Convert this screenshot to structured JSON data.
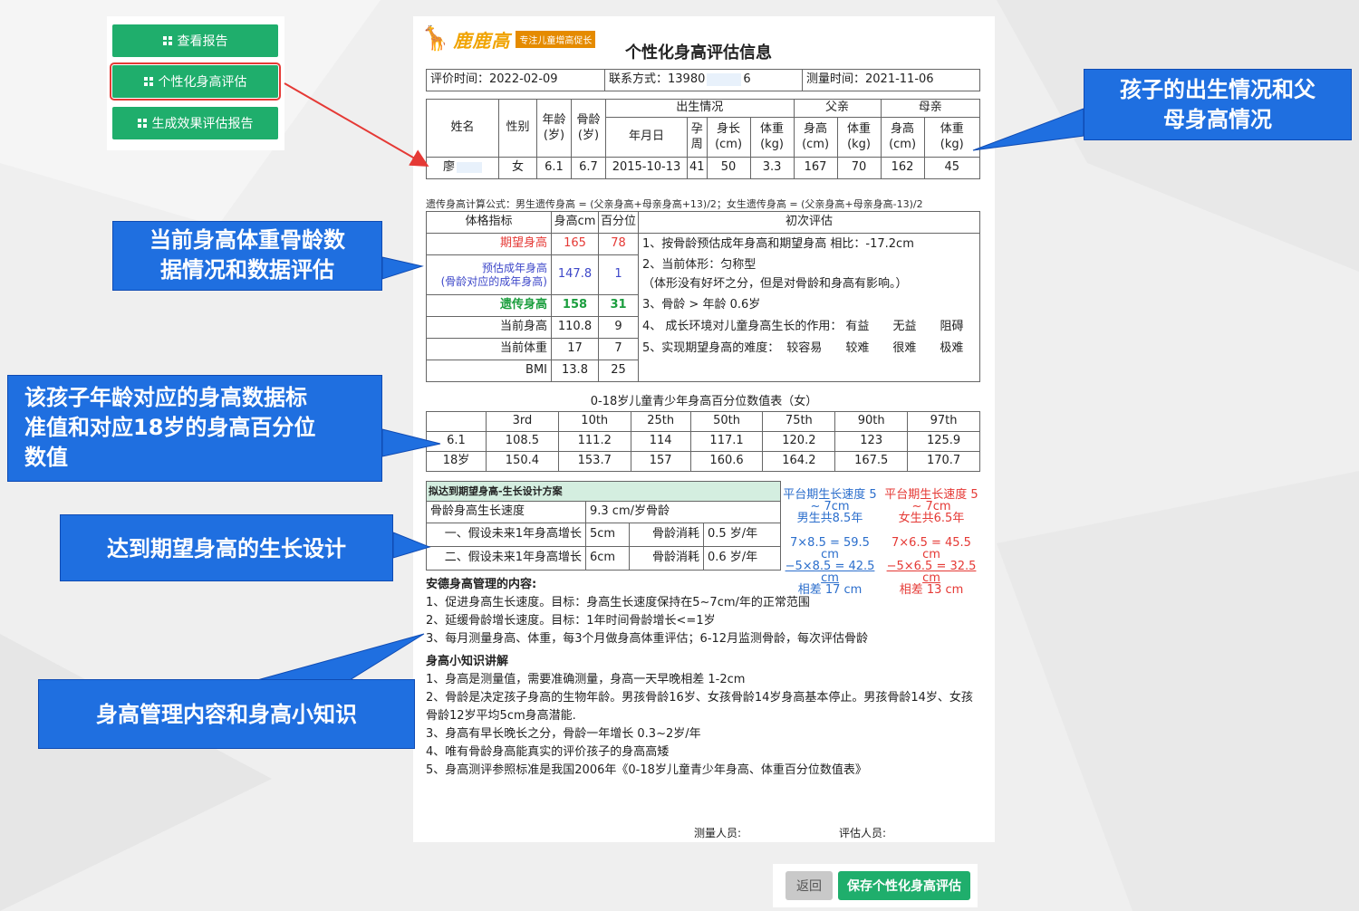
{
  "menu": {
    "items": [
      {
        "label": "查看报告"
      },
      {
        "label": "个性化身高评估"
      },
      {
        "label": "生成效果评估报告"
      }
    ]
  },
  "report": {
    "brand": "鹿鹿高",
    "slogan": "专注儿童增高促长",
    "title": "个性化身高评估信息",
    "meta": {
      "eval_time": "评价时间：2022-02-09",
      "contact": "联系方式：13980",
      "contact_tail": "6",
      "measure_time": "测量时间：2021-11-06"
    },
    "patient": {
      "headers": {
        "name": "姓名",
        "gender": "性别",
        "age": "年龄\n(岁)",
        "bone_age": "骨龄\n(岁)",
        "birth": "出生情况",
        "father": "父亲",
        "mother": "母亲",
        "dob": "年月日",
        "gest": "孕\n周",
        "length": "身长\n(cm)",
        "weight": "体重\n(kg)",
        "f_height": "身高\n(cm)",
        "f_weight": "体重\n(kg)",
        "m_height": "身高\n(cm)",
        "m_weight": "体重\n(kg)"
      },
      "values": {
        "name": "廖",
        "gender": "女",
        "age": "6.1",
        "bone_age": "6.7",
        "dob": "2015-10-13",
        "gest": "41",
        "length": "50",
        "weight": "3.3",
        "f_height": "167",
        "f_weight": "70",
        "m_height": "162",
        "m_weight": "45"
      }
    },
    "formula": "遗传身高计算公式：男生遗传身高 = (父亲身高+母亲身高+13)/2；女生遗传身高 = (父亲身高+母亲身高-13)/2",
    "metrics": {
      "headers": {
        "indicator": "体格指标",
        "height": "身高cm",
        "percentile": "百分位",
        "eval": "初次评估"
      },
      "rows": [
        {
          "label": "期望身高",
          "h": "165",
          "p": "78"
        },
        {
          "label": "预估成年身高\n(骨龄对应的成年身高)",
          "h": "147.8",
          "p": "1"
        },
        {
          "label": "遗传身高",
          "h": "158",
          "p": "31"
        },
        {
          "label": "当前身高",
          "h": "110.8",
          "p": "9"
        },
        {
          "label": "当前体重",
          "h": "17",
          "p": "7"
        },
        {
          "label": "BMI",
          "h": "13.8",
          "p": "25"
        }
      ],
      "evals": {
        "e1": "1、按骨龄预估成年身高和期望身高 相比：-17.2cm",
        "e2a": "2、当前体形：匀称型",
        "e2b": "（体形没有好坏之分，但是对骨龄和身高有影响。）",
        "e3": "3、骨龄 > 年龄 0.6岁",
        "e4": "4、 成长环境对儿童身高生长的作用：",
        "e4_opts": [
          "有益",
          "无益",
          "阻碍"
        ],
        "e5": "5、实现期望身高的难度：",
        "e5_opts": [
          "较容易",
          "较难",
          "很难",
          "极难"
        ]
      }
    },
    "percentile_table": {
      "title": "0-18岁儿童青少年身高百分位数值表（女）",
      "headers": [
        "",
        "3rd",
        "10th",
        "25th",
        "50th",
        "75th",
        "90th",
        "97th"
      ],
      "rows": [
        [
          "6.1",
          "108.5",
          "111.2",
          "114",
          "117.1",
          "120.2",
          "123",
          "125.9"
        ],
        [
          "18岁",
          "150.4",
          "153.7",
          "157",
          "160.6",
          "164.2",
          "167.5",
          "170.7"
        ]
      ]
    },
    "plan": {
      "heading": "拟达到期望身高-生长设计方案",
      "speed_label": "骨龄身高生长速度",
      "speed_value": "9.3 cm/岁骨龄",
      "rows": [
        {
          "label": "一、假设未来1年身高增长",
          "growth": "5cm",
          "bone_label": "骨龄消耗",
          "bone_value": "0.5 岁/年"
        },
        {
          "label": "二、假设未来1年身高增长",
          "growth": "6cm",
          "bone_label": "骨龄消耗",
          "bone_value": "0.6 岁/年"
        }
      ],
      "male_note": {
        "head": "平台期生长速度 5 ~ 7cm",
        "sub": "男生共8.5年",
        "l1": "7×8.5 = 59.5 cm",
        "l2": "−5×8.5 = 42.5 cm",
        "l3": "相差   17 cm"
      },
      "female_note": {
        "head": "平台期生长速度 5 ~ 7cm",
        "sub": "女生共6.5年",
        "l1": "7×6.5 = 45.5 cm",
        "l2": "−5×6.5 = 32.5 cm",
        "l3": "相差   13 cm"
      }
    },
    "management": {
      "heading": "安德身高管理的内容:",
      "items": [
        "1、促进身高生长速度。目标：身高生长速度保持在5~7cm/年的正常范围",
        "2、延缓骨龄增长速度。目标：1年时间骨龄增长<=1岁",
        "3、每月测量身高、体重，每3个月做身高体重评估；6-12月监测骨龄，每次评估骨龄"
      ]
    },
    "knowledge": {
      "heading": "身高小知识讲解",
      "items": [
        "1、身高是测量值，需要准确测量，身高一天早晚相差 1-2cm",
        "2、骨龄是决定孩子身高的生物年龄。男孩骨龄16岁、女孩骨龄14岁身高基本停止。男孩骨龄14岁、女孩",
        "骨龄12岁平均5cm身高潜能.",
        "3、身高有早长晚长之分，骨龄一年增长 0.3~2岁/年",
        "4、唯有骨龄身高能真实的评价孩子的身高高矮",
        "5、身高测评参照标准是我国2006年《0-18岁儿童青少年身高、体重百分位数值表》"
      ]
    },
    "signature": {
      "measurer": "测量人员:",
      "evaluator": "评估人员:"
    }
  },
  "buttons": {
    "back": "返回",
    "save": "保存个性化身高评估"
  },
  "callouts": {
    "parents": [
      "孩子的出生情况和父",
      "母身高情况"
    ],
    "metrics": [
      "当前身高体重骨龄数",
      "据情况和数据评估"
    ],
    "percentile": [
      "该孩子年龄对应的身高数据标",
      "准值和对应18岁的身高百分位",
      "数值"
    ],
    "growth": [
      "达到期望身高的生长设计"
    ],
    "knowledge": [
      "身高管理内容和身高小知识"
    ]
  },
  "colors": {
    "accent_green": "#1fae6c",
    "callout_blue": "#1f6fe0",
    "highlight_red": "#e53935",
    "brand_orange": "#f0a300"
  }
}
